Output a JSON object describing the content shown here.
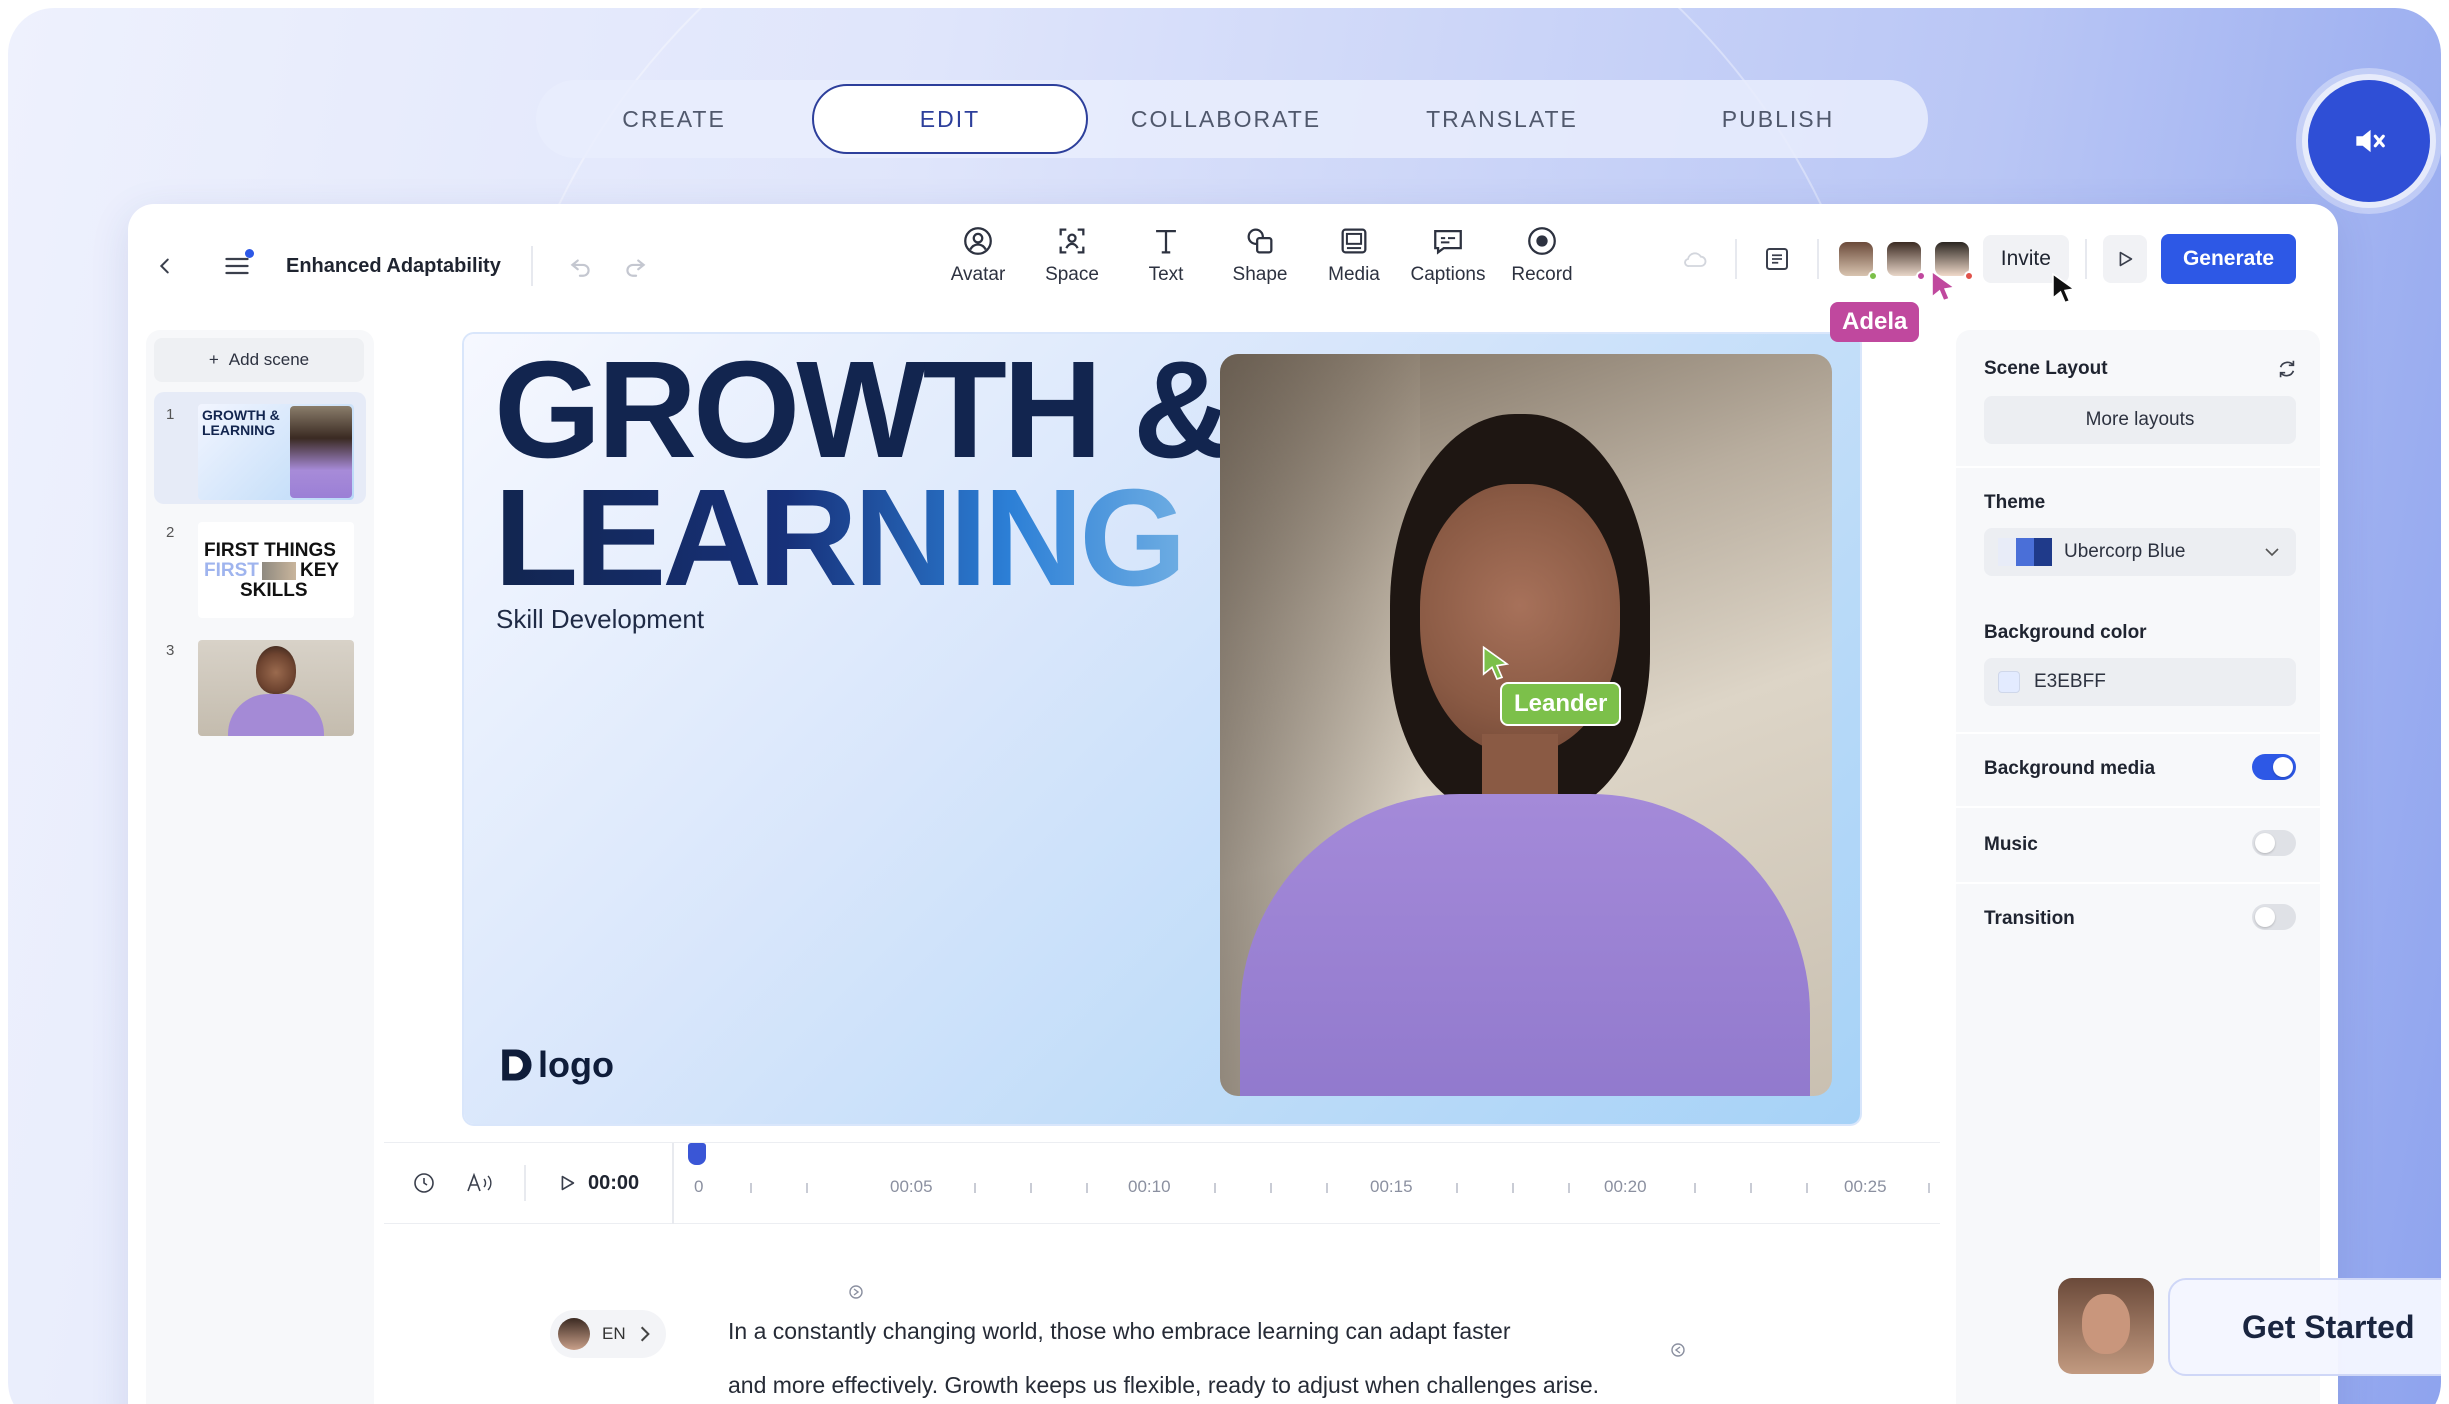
{
  "mode_tabs": [
    "CREATE",
    "EDIT",
    "COLLABORATE",
    "TRANSLATE",
    "PUBLISH"
  ],
  "active_mode": "EDIT",
  "toolbar": {
    "doc_title": "Enhanced Adaptability",
    "tools": [
      "Avatar",
      "Space",
      "Text",
      "Shape",
      "Media",
      "Captions",
      "Record"
    ],
    "invite_label": "Invite",
    "generate_label": "Generate"
  },
  "scenes": {
    "add_label": "Add scene",
    "items": [
      {
        "num": "1",
        "thumb_text": "GROWTH & LEARNING"
      },
      {
        "num": "2",
        "thumb_text_top": "FIRST THINGS",
        "thumb_text_mid_left": "FIRST",
        "thumb_text_mid_right": "KEY",
        "thumb_text_bottom": "SKILLS"
      },
      {
        "num": "3"
      }
    ]
  },
  "slide": {
    "title_line1": "GROWTH &",
    "title_line2": "LEARNING",
    "subtitle": "Skill Development",
    "logo_text": "logo"
  },
  "cursors": {
    "adela": {
      "name": "Adela",
      "color": "#c0489e"
    },
    "leander": {
      "name": "Leander",
      "color": "#7cc04a"
    }
  },
  "timeline": {
    "current_time": "00:00",
    "labels": [
      "0",
      "00:05",
      "00:10",
      "00:15",
      "00:20",
      "00:25"
    ]
  },
  "script": {
    "language": "EN",
    "line1": "In a constantly changing world, those who embrace learning can adapt faster",
    "line2": "and more effectively. Growth keeps us flexible, ready to adjust when challenges arise."
  },
  "properties": {
    "scene_layout_label": "Scene Layout",
    "more_layouts_label": "More layouts",
    "theme_label": "Theme",
    "theme_value": "Ubercorp Blue",
    "bg_color_label": "Background color",
    "bg_color_value": "E3EBFF",
    "bg_media_label": "Background media",
    "bg_media_on": true,
    "music_label": "Music",
    "music_on": false,
    "transition_label": "Transition",
    "transition_on": false
  },
  "cta": {
    "label": "Get Started"
  },
  "colors": {
    "accent": "#2d58e6",
    "brand_navy": "#12254f"
  }
}
